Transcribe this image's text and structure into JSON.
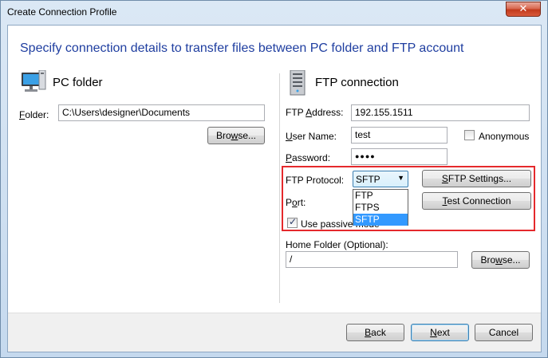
{
  "window": {
    "title": "Create Connection Profile",
    "close_glyph": "✕"
  },
  "heading": "Specify connection details to transfer files between PC folder and FTP account",
  "pc": {
    "title": "PC folder",
    "icon": "pc-monitor-icon",
    "folder_label": "Folder:",
    "folder_value": "C:\\Users\\designer\\Documents",
    "browse_label": "Browse..."
  },
  "ftp": {
    "title": "FTP connection",
    "icon": "ftp-server-icon",
    "address_label": "FTP Address:",
    "address_value": "192.155.1511",
    "user_label": "User Name:",
    "user_value": "test",
    "anonymous_label": "Anonymous",
    "anonymous_checked": false,
    "password_label": "Password:",
    "password_value": "●●●●",
    "protocol_label": "FTP Protocol:",
    "protocol_value": "SFTP",
    "protocol_options": [
      "FTP",
      "FTPS",
      "SFTP"
    ],
    "settings_button": "SFTP Settings...",
    "port_label": "Port:",
    "test_button": "Test Connection",
    "passive_label": "Use passive mode",
    "passive_checked": true,
    "home_label": "Home Folder (Optional):",
    "home_value": "/",
    "browse_label": "Browse..."
  },
  "buttons": {
    "back": "Back",
    "next": "Next",
    "cancel": "Cancel"
  },
  "colors": {
    "heading": "#1f3ea0",
    "highlight": "#e5292c",
    "selection": "#3399ff"
  }
}
